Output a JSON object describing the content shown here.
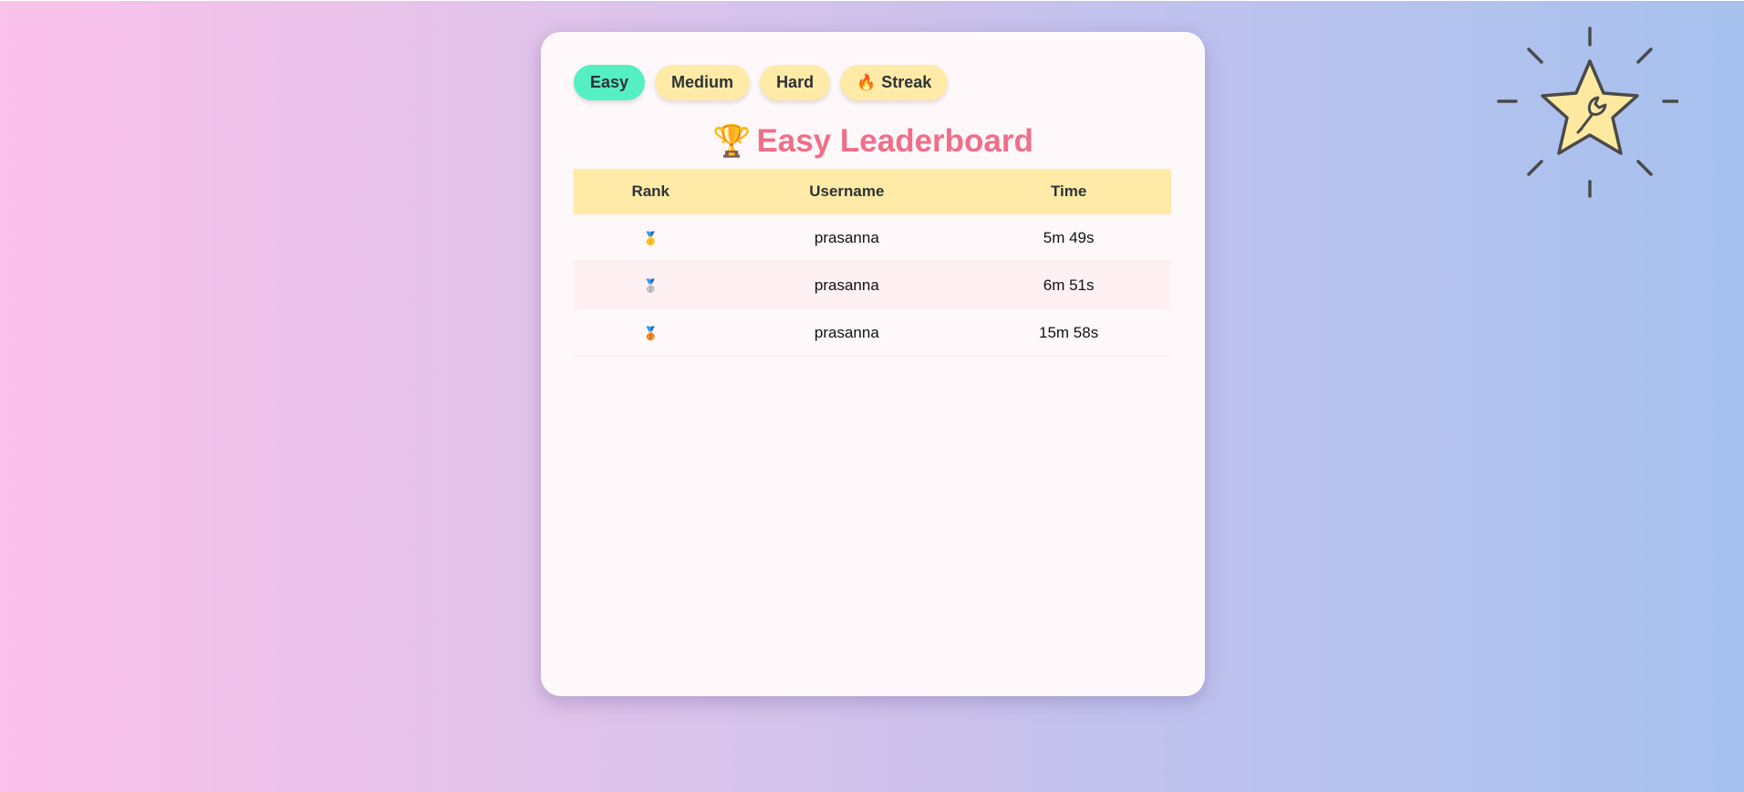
{
  "tabs": [
    {
      "label": "Easy",
      "active": true
    },
    {
      "label": "Medium",
      "active": false
    },
    {
      "label": "Hard",
      "active": false
    },
    {
      "label": "Streak",
      "icon": "fire-icon",
      "active": false
    }
  ],
  "leaderboard": {
    "title": "Easy Leaderboard",
    "title_icon": "trophy-icon",
    "columns": [
      "Rank",
      "Username",
      "Time"
    ],
    "rows": [
      {
        "rank_icon": "gold-medal-icon",
        "username": "prasanna",
        "time": "5m 49s"
      },
      {
        "rank_icon": "silver-medal-icon",
        "username": "prasanna",
        "time": "6m 51s"
      },
      {
        "rank_icon": "bronze-medal-icon",
        "username": "prasanna",
        "time": "15m 58s"
      }
    ]
  },
  "settings_button": {
    "icon": "star-wrench-icon"
  },
  "colors": {
    "accent_title": "#f06e88",
    "tab_active": "#55efc4",
    "tab_inactive": "#ffeaa7",
    "table_header": "#ffeaa7",
    "row_alt": "#fff0f3",
    "card": "#fff8fa"
  }
}
